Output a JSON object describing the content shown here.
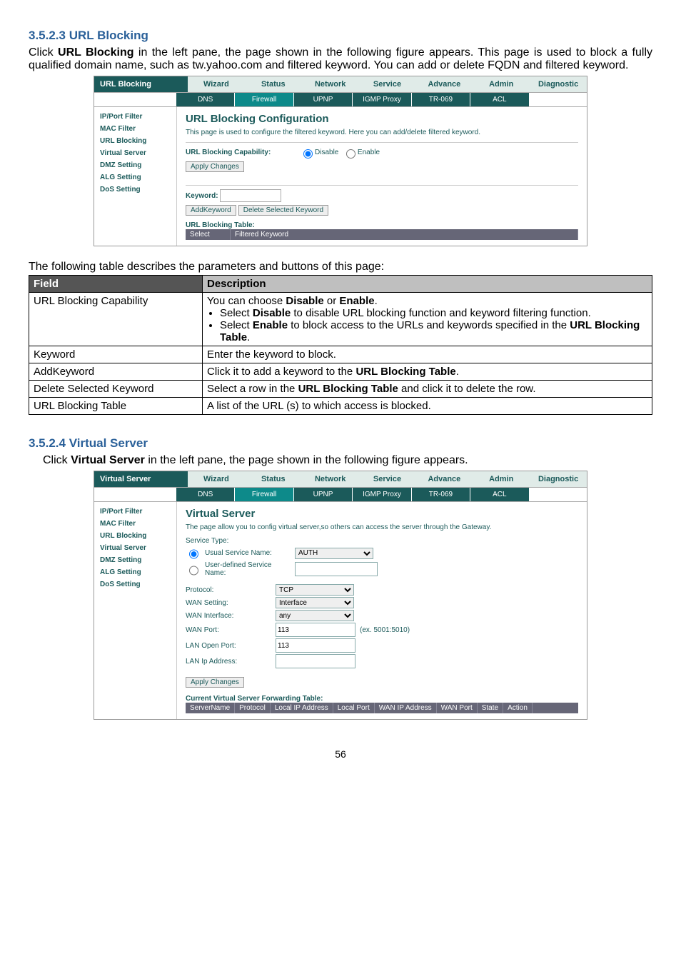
{
  "section1": {
    "heading": "3.5.2.3 URL Blocking",
    "para": "Click URL Blocking in the left pane, the page shown in the following figure appears. This page is used to block a fully qualified domain name, such as tw.yahoo.com and filtered keyword. You can add or delete FQDN and filtered keyword."
  },
  "shot1": {
    "title_left": "URL Blocking",
    "tabs": [
      "Wizard",
      "Status",
      "Network",
      "Service",
      "Advance",
      "Admin",
      "Diagnostic"
    ],
    "subtabs": [
      "DNS",
      "Firewall",
      "UPNP",
      "IGMP Proxy",
      "TR-069",
      "ACL"
    ],
    "side": [
      "IP/Port Filter",
      "MAC Filter",
      "URL Blocking",
      "Virtual Server",
      "DMZ Setting",
      "ALG Setting",
      "DoS Setting"
    ],
    "pane_title": "URL Blocking Configuration",
    "pane_desc": "This page is used to configure the filtered keyword. Here you can add/delete filtered keyword.",
    "cap_label": "URL Blocking Capability:",
    "radio_disable": "Disable",
    "radio_enable": "Enable",
    "apply_btn": "Apply Changes",
    "keyword_label": "Keyword:",
    "add_btn": "AddKeyword",
    "del_btn": "Delete Selected Keyword",
    "table_label": "URL Blocking Table:",
    "table_cols": [
      "Select",
      "Filtered Keyword"
    ]
  },
  "param1": {
    "intro": "The following table describes the parameters and buttons of this page:",
    "headers": {
      "field": "Field",
      "desc": "Description"
    },
    "rows": [
      {
        "field": "URL Blocking Capability",
        "desc_lines": [
          "You can choose Disable or Enable.",
          "Select Disable to disable URL blocking function and keyword filtering function.",
          "Select Enable to block access to the URLs and keywords specified in the URL Blocking Table."
        ],
        "bulleted": [
          1,
          2
        ]
      },
      {
        "field": "Keyword",
        "desc": "Enter the keyword to block."
      },
      {
        "field": "AddKeyword",
        "desc": "Click it to add a keyword to the URL Blocking Table."
      },
      {
        "field": "Delete Selected Keyword",
        "desc": "Select a row in the URL Blocking Table and click it to delete the row."
      },
      {
        "field": "URL Blocking Table",
        "desc": "A list of the URL (s) to which access is blocked."
      }
    ]
  },
  "section2": {
    "heading": "3.5.2.4 Virtual Server",
    "para": "Click Virtual Server in the left pane, the page shown in the following figure appears."
  },
  "shot2": {
    "title_left": "Virtual Server",
    "tabs": [
      "Wizard",
      "Status",
      "Network",
      "Service",
      "Advance",
      "Admin",
      "Diagnostic"
    ],
    "subtabs": [
      "DNS",
      "Firewall",
      "UPNP",
      "IGMP Proxy",
      "TR-069",
      "ACL"
    ],
    "side": [
      "IP/Port Filter",
      "MAC Filter",
      "URL Blocking",
      "Virtual Server",
      "DMZ Setting",
      "ALG Setting",
      "DoS Setting"
    ],
    "pane_title": "Virtual Server",
    "pane_desc": "The page allow you to config virtual server,so others can access the server through the Gateway.",
    "svc_type_label": "Service Type:",
    "usual_label": "Usual Service Name:",
    "usual_value": "AUTH",
    "user_label": "User-defined Service Name:",
    "rows": [
      {
        "label": "Protocol:",
        "value": "TCP",
        "type": "select"
      },
      {
        "label": "WAN Setting:",
        "value": "Interface",
        "type": "select"
      },
      {
        "label": "WAN Interface:",
        "value": "any",
        "type": "select"
      },
      {
        "label": "WAN Port:",
        "value": "113",
        "note": "(ex. 5001:5010)"
      },
      {
        "label": "LAN Open Port:",
        "value": "113"
      },
      {
        "label": "LAN Ip Address:",
        "value": ""
      }
    ],
    "apply_btn": "Apply Changes",
    "fwd_label": "Current Virtual Server Forwarding Table:",
    "fwd_cols": [
      "ServerName",
      "Protocol",
      "Local IP Address",
      "Local Port",
      "WAN IP Address",
      "WAN Port",
      "State",
      "Action"
    ]
  },
  "page_num": "56"
}
